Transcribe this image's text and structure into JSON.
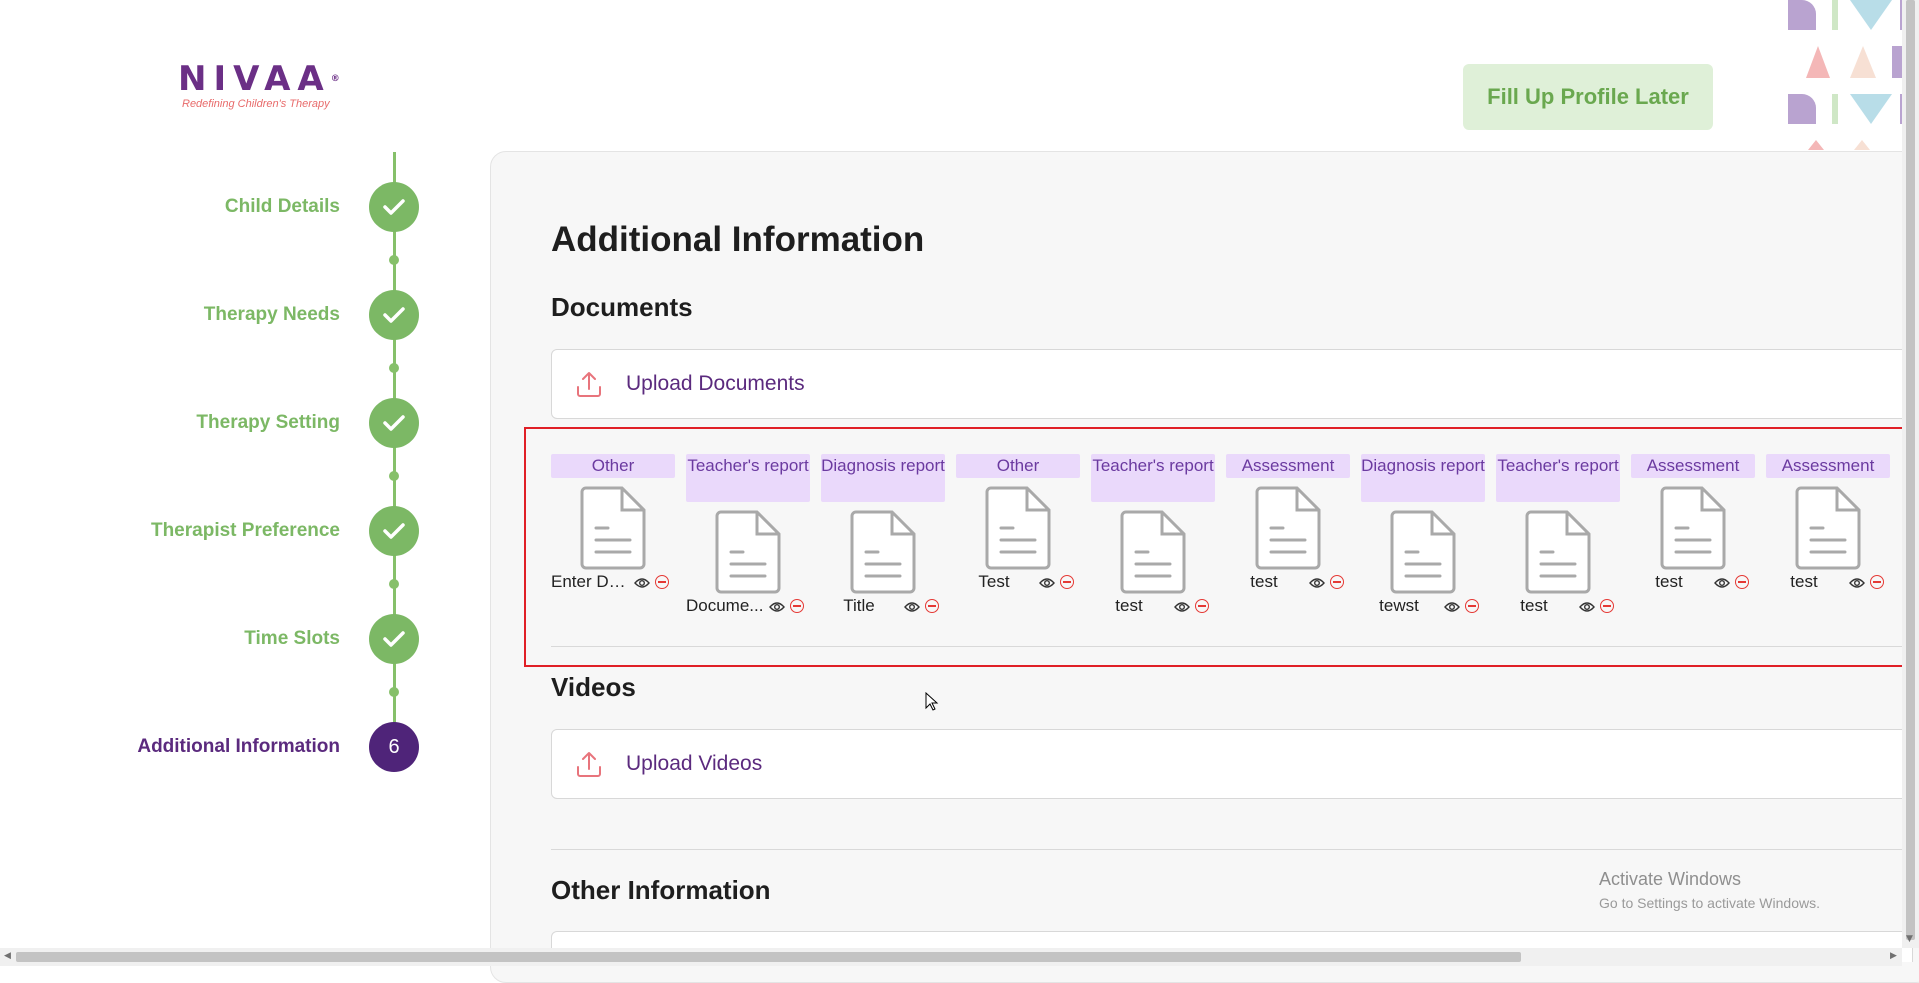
{
  "brand": {
    "name": "NIVAA",
    "registered": "®",
    "tagline": "Redefining Children's Therapy"
  },
  "header": {
    "fill_later_label": "Fill Up Profile Later"
  },
  "steps": [
    {
      "label": "Child Details",
      "status": "done"
    },
    {
      "label": "Therapy Needs",
      "status": "done"
    },
    {
      "label": "Therapy Setting",
      "status": "done"
    },
    {
      "label": "Therapist Preference",
      "status": "done"
    },
    {
      "label": "Time Slots",
      "status": "done"
    },
    {
      "label": "Additional Information",
      "status": "active",
      "number": "6"
    }
  ],
  "main": {
    "title": "Additional Information",
    "documents": {
      "heading": "Documents",
      "upload_label": "Upload Documents",
      "items": [
        {
          "type": "Other",
          "name": "Enter Do..."
        },
        {
          "type": "Teacher's report",
          "name": "Docume..."
        },
        {
          "type": "Diagnosis report",
          "name": "Title"
        },
        {
          "type": "Other",
          "name": "Test"
        },
        {
          "type": "Teacher's report",
          "name": "test"
        },
        {
          "type": "Assessment",
          "name": "test"
        },
        {
          "type": "Diagnosis report",
          "name": "tewst"
        },
        {
          "type": "Teacher's report",
          "name": "test"
        },
        {
          "type": "Assessment",
          "name": "test"
        },
        {
          "type": "Assessment",
          "name": "test"
        }
      ]
    },
    "videos": {
      "heading": "Videos",
      "upload_label": "Upload Videos"
    },
    "other": {
      "heading": "Other Information"
    }
  },
  "watermark": {
    "title": "Activate Windows",
    "subtitle": "Go to Settings to activate Windows."
  },
  "colors": {
    "brand_purple": "#5b2a7e",
    "step_green": "#7cb865",
    "tag_bg": "#ead9fb",
    "remove_red": "#e53935"
  }
}
